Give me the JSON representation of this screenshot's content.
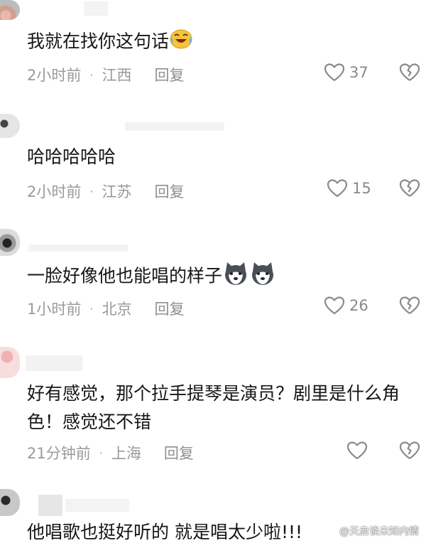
{
  "comments": [
    {
      "text": "我就在找你这句话",
      "time": "2小时前",
      "location": "江西",
      "reply": "回复",
      "likes": "37"
    },
    {
      "text": "哈哈哈哈哈",
      "time": "2小时前",
      "location": "江苏",
      "reply": "回复",
      "likes": "15"
    },
    {
      "text": "一脸好像他也能唱的样子",
      "time": "1小时前",
      "location": "北京",
      "reply": "回复",
      "likes": "26"
    },
    {
      "text": "好有感觉，那个拉手提琴是演员？剧里是什么角色！感觉还不错",
      "time": "21分钟前",
      "location": "上海",
      "reply": "回复",
      "likes": ""
    },
    {
      "text": "他唱歌也挺好听的  就是唱太少啦!!!"
    }
  ],
  "watermark": "@天启谈未知内情",
  "icons": {
    "like": "heart-outline-icon",
    "dislike": "broken-heart-icon",
    "emoji_laugh_cry": "laugh-cry-emoji-icon",
    "emoji_husky": "husky-dog-emoji-icon"
  },
  "colors": {
    "meta_gray": "#9a9a9a",
    "text_dark": "#161616",
    "icon_gray": "#8a8a8a"
  }
}
